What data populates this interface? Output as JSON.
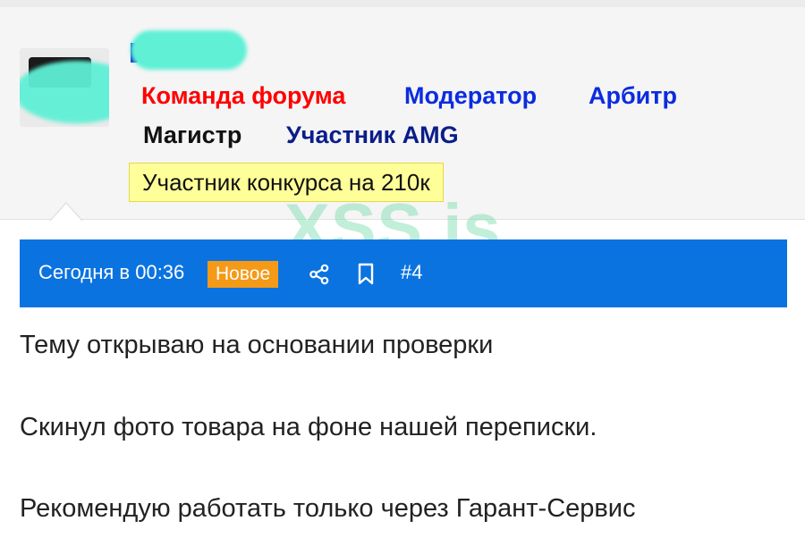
{
  "user": {
    "roles": [
      "Команда форума",
      "Модератор",
      "Арбитр",
      "Магистр",
      "Участник AMG"
    ],
    "banner": "Участник конкурса на 210к"
  },
  "watermark": "XSS.is",
  "post": {
    "date": "Сегодня в 00:36",
    "badge": "Новое",
    "number": "#4",
    "icons": [
      "share-icon",
      "bookmark-icon"
    ],
    "body": [
      "Тему открываю на основании проверки",
      "Скинул фото товара на фоне нашей переписки.",
      "Рекомендую работать только через Гарант-Сервис"
    ]
  },
  "colors": {
    "accent": "#0a73e0",
    "new_badge": "#f59a17",
    "role_team": "#ff0000",
    "role_blue": "#0b2ce0",
    "role_dark_blue": "#0a1d8a",
    "banner_bg": "#ffff99"
  }
}
